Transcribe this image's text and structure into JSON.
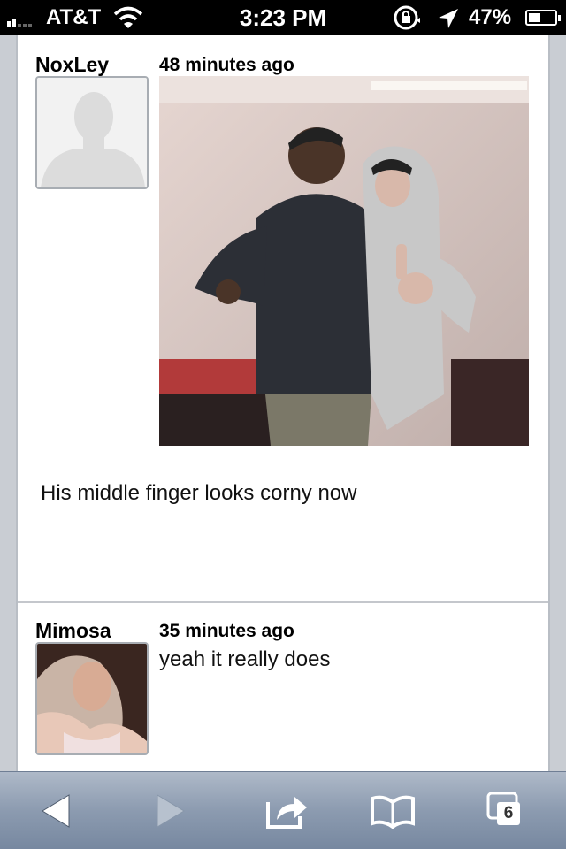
{
  "status_bar": {
    "carrier": "AT&T",
    "time": "3:23 PM",
    "battery_text": "47%",
    "battery_level": 0.47
  },
  "posts": [
    {
      "username": "NoxLey",
      "timestamp": "48 minutes ago",
      "text": "His middle finger looks corny now",
      "avatar": "default-silhouette",
      "has_photo": true
    },
    {
      "username": "Mimosa",
      "timestamp": "35 minutes ago",
      "text": "yeah it really does",
      "avatar": "user-photo"
    }
  ],
  "toolbar": {
    "back_icon": "back-arrow",
    "forward_icon": "forward-arrow",
    "share_icon": "share",
    "bookmarks_icon": "open-book",
    "tabs_icon": "tabs",
    "tabs_count": "6"
  },
  "colors": {
    "toolbar": "#8c9bb0",
    "status_bar": "#000000",
    "content_bg": "#ffffff"
  }
}
